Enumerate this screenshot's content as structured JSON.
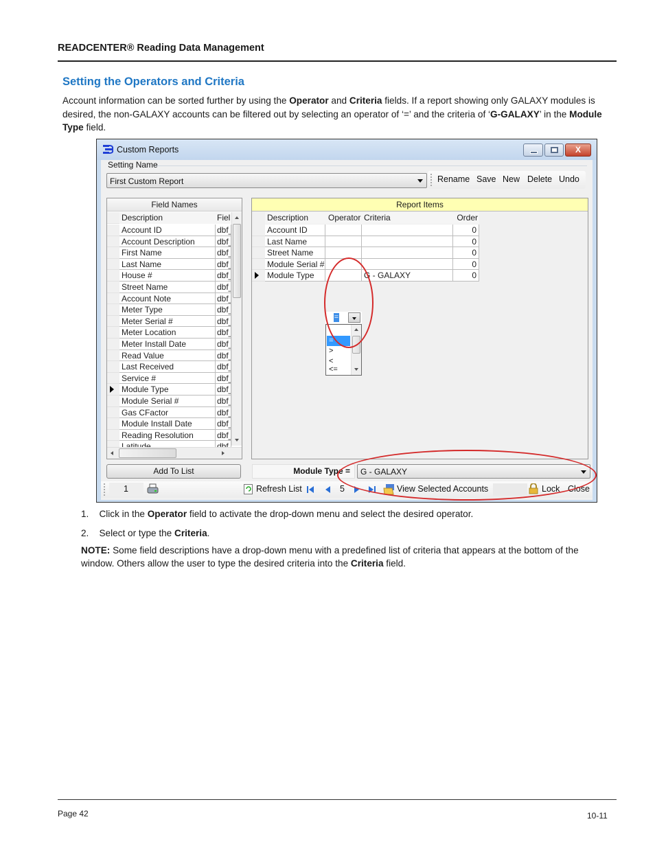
{
  "page": {
    "header": "READCENTER® Reading Data Management",
    "section_title": "Setting the Operators and Criteria",
    "intro": {
      "p1": "Account information can be sorted further by using the ",
      "b1": "Operator",
      "p2": " and ",
      "b2": "Criteria",
      "p3": " fields. If a report showing only GALAXY modules is desired, the non-GALAXY accounts can be filtered out by selecting an operator of ‘=’ and the criteria of ‘",
      "b3": "G-GALAXY",
      "p4": "’ in the ",
      "b4": "Module Type",
      "p5": " field."
    },
    "steps": [
      {
        "num": "1.",
        "pre": "Click in the ",
        "bold": "Operator",
        "post": " field to activate the drop-down menu and select the desired operator."
      },
      {
        "num": "2.",
        "pre": "Select or type the ",
        "bold": "Criteria",
        "post": "."
      }
    ],
    "note": {
      "label": "NOTE:",
      "text": "  Some field descriptions have a drop-down menu with a predefined list of criteria that appears at the bottom of the window. Others allow the user to type the desired criteria into the ",
      "bold": "Criteria",
      "post": " field."
    },
    "footer": {
      "page": "Page 42",
      "version": "10-11"
    }
  },
  "window": {
    "title": "Custom Reports",
    "close_glyph": "X",
    "setting_name_label": "Setting Name",
    "setting_name_value": "First Custom Report",
    "toolbar": [
      "Rename",
      "Save",
      "New",
      "Delete",
      "Undo"
    ],
    "field_names": {
      "title": "Field Names",
      "col_description": "Description",
      "col_field": "Fiel",
      "rows": [
        {
          "d": "Account ID",
          "f": "dbf_"
        },
        {
          "d": "Account Description",
          "f": "dbf_"
        },
        {
          "d": "First Name",
          "f": "dbf_"
        },
        {
          "d": "Last Name",
          "f": "dbf_"
        },
        {
          "d": "House #",
          "f": "dbf_"
        },
        {
          "d": "Street Name",
          "f": "dbf_"
        },
        {
          "d": "Account Note",
          "f": "dbf_"
        },
        {
          "d": "Meter Type",
          "f": "dbf_"
        },
        {
          "d": "Meter Serial #",
          "f": "dbf_"
        },
        {
          "d": "Meter Location",
          "f": "dbf_"
        },
        {
          "d": "Meter Install Date",
          "f": "dbf_"
        },
        {
          "d": "Read Value",
          "f": "dbf_"
        },
        {
          "d": "Last Received",
          "f": "dbf_"
        },
        {
          "d": "Service #",
          "f": "dbf_"
        },
        {
          "d": "Module Type",
          "f": "dbf_"
        },
        {
          "d": "Module Serial #",
          "f": "dbf_"
        },
        {
          "d": "Gas CFactor",
          "f": "dbf_"
        },
        {
          "d": "Module Install Date",
          "f": "dbf_"
        },
        {
          "d": "Reading Resolution",
          "f": "dbf_"
        },
        {
          "d": "Latitude",
          "f": "dbf"
        }
      ],
      "current_row": 14
    },
    "report_items": {
      "title": "Report Items",
      "columns": [
        "Description",
        "Operator",
        "Criteria",
        "Order"
      ],
      "rows": [
        {
          "description": "Account ID",
          "operator": "",
          "criteria": "",
          "order": "0"
        },
        {
          "description": "Last Name",
          "operator": "",
          "criteria": "",
          "order": "0"
        },
        {
          "description": "Street Name",
          "operator": "",
          "criteria": "",
          "order": "0"
        },
        {
          "description": "Module Serial #",
          "operator": "",
          "criteria": "",
          "order": "0"
        },
        {
          "description": "Module Type",
          "operator": "=",
          "criteria": "G - GALAXY",
          "order": "0"
        }
      ],
      "current_row": 4,
      "operator_options": [
        "",
        "=",
        ">",
        "<",
        "<="
      ],
      "selected_operator": "="
    },
    "add_to_list": "Add To List",
    "criteria_label": "Module Type =",
    "criteria_value": "G - GALAXY",
    "status": {
      "record": "1",
      "refresh": "Refresh List",
      "page": "5",
      "view_selected": "View Selected Accounts",
      "lock": "Lock",
      "close": "Close"
    },
    "annotation_color": "#d42a2a",
    "accent": "#1f77c4"
  }
}
